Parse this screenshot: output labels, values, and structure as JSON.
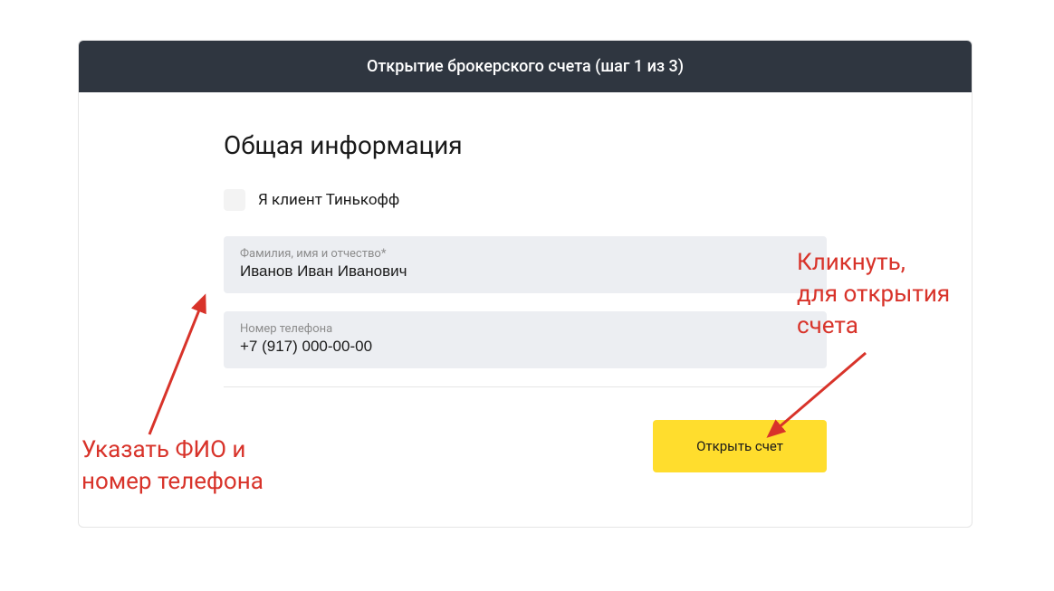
{
  "header": {
    "title": "Открытие брокерского счета (шаг 1 из 3)"
  },
  "section": {
    "title": "Общая информация"
  },
  "checkbox": {
    "label": "Я клиент Тинькофф"
  },
  "fields": {
    "fullname": {
      "label": "Фамилия, имя и отчество*",
      "value": "Иванов Иван Иванович"
    },
    "phone": {
      "label": "Номер телефона",
      "value": "+7 (917) 000-00-00"
    }
  },
  "actions": {
    "submit_label": "Открыть счет"
  },
  "annotations": {
    "left": "Указать ФИО и\nномер телефона",
    "right": "Кликнуть,\nдля открытия\nсчета"
  },
  "colors": {
    "header_bg": "#2f3640",
    "accent": "#ffdd2d",
    "annotation": "#d8332a",
    "input_bg": "#eceef2"
  }
}
